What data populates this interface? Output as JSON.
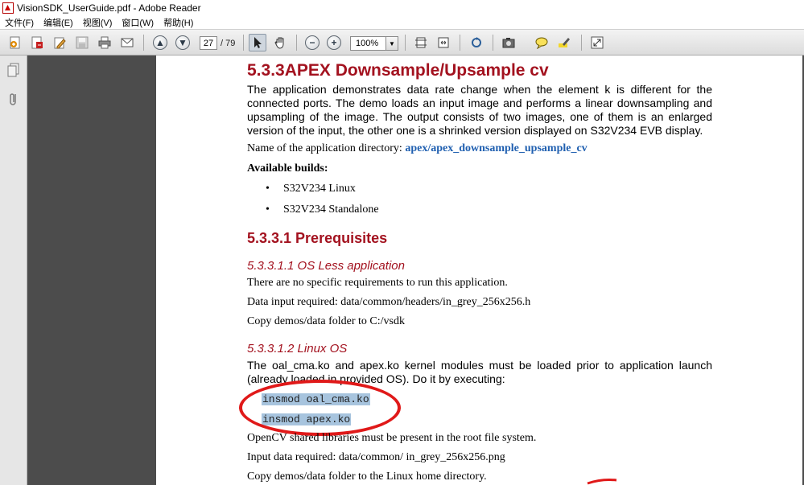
{
  "window": {
    "title": "VisionSDK_UserGuide.pdf - Adobe Reader"
  },
  "menu": [
    "文件(F)",
    "编辑(E)",
    "视图(V)",
    "窗口(W)",
    "帮助(H)"
  ],
  "toolbar": {
    "page_current": "27",
    "page_total": "/ 79",
    "zoom": "100%"
  },
  "document": {
    "heading": "5.3.3APEX Downsample/Upsample cv",
    "intro": "The application demonstrates data rate change when the element k is different for the connected ports. The demo loads an input image and performs a linear downsampling and upsampling of the image. The output consists of two images, one of them is an enlarged version of the input, the other one is a shrinked version displayed on S32V234 EVB display.",
    "app_dir_label": "Name of the application directory: ",
    "app_dir_value": "apex/apex_downsample_upsample_cv",
    "builds_label": "Available builds:",
    "builds": [
      "S32V234 Linux",
      "S32V234 Standalone"
    ],
    "prereq_heading": "5.3.3.1 Prerequisites",
    "os_less_heading": "5.3.3.1.1 OS Less application",
    "os_less_lines": [
      "There are no specific requirements to run this application.",
      "Data input required: data/common/headers/in_grey_256x256.h",
      "Copy demos/data folder to C:/vsdk"
    ],
    "linux_heading": "5.3.3.1.2 Linux OS",
    "linux_intro": "The oal_cma.ko and apex.ko kernel modules must be loaded prior to application launch (already loaded in provided OS). Do it by executing:",
    "commands": [
      "insmod oal_cma.ko",
      "insmod apex.ko"
    ],
    "linux_lines": [
      "OpenCV shared libraries must be present in the root file system.",
      "Input data required: data/common/ in_grey_256x256.png",
      "Copy demos/data folder to the Linux home directory."
    ]
  }
}
